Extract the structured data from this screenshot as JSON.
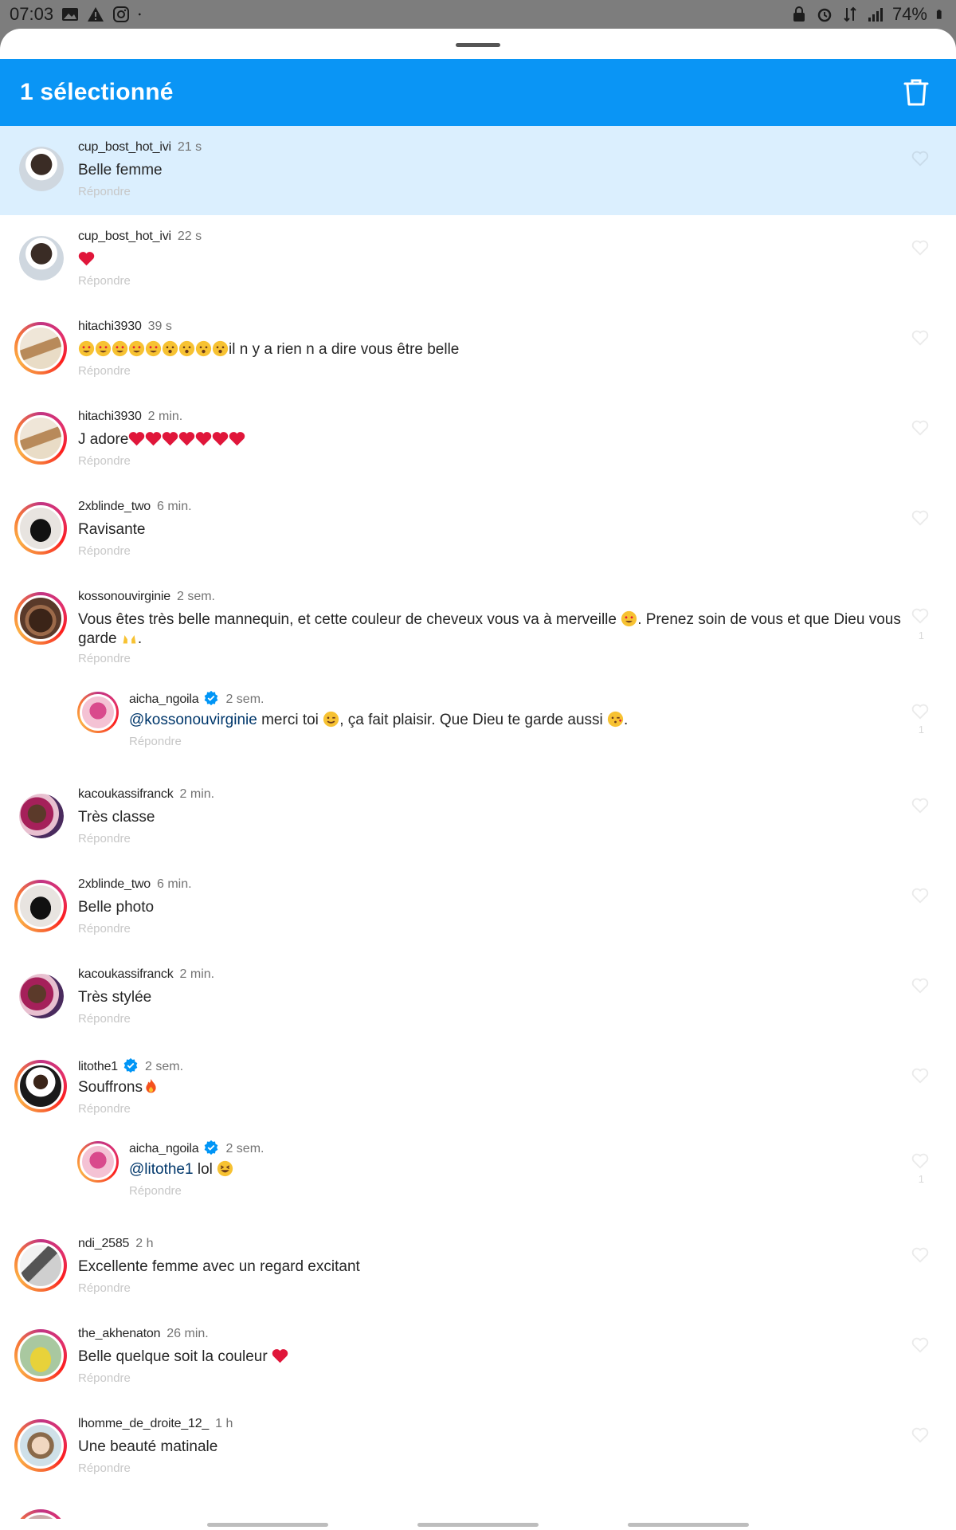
{
  "status_bar": {
    "time": "07:03",
    "battery": "74%",
    "left_icons": [
      "image-icon",
      "warning-icon",
      "instagram-icon",
      "dot-icon"
    ],
    "right_icons": [
      "lock-icon",
      "alarm-icon",
      "signal-transfer-icon",
      "signal-icon",
      "battery-icon"
    ]
  },
  "action_bar": {
    "title": "1 sélectionné",
    "trash_icon": "trash-icon",
    "color": "#0a95f5"
  },
  "reply_label": "Répondre",
  "comments": [
    {
      "username": "cup_bost_hot_ivi",
      "time": "21 s",
      "text": "Belle femme",
      "selected": true
    },
    {
      "username": "cup_bost_hot_ivi",
      "time": "22 s",
      "text": ""
    },
    {
      "username": "hitachi3930",
      "time": "39 s",
      "text": "il n y a rien n a dire vous être belle"
    },
    {
      "username": "hitachi3930",
      "time": "2 min.",
      "text": "J adore"
    },
    {
      "username": "2xblinde_two",
      "time": "6 min.",
      "text": "Ravisante"
    },
    {
      "username": "kossonouvirginie",
      "time": "2 sem.",
      "text_parts": [
        "Vous êtes très belle mannequin, et cette couleur de cheveux vous va à merveille ",
        ". Prenez soin de vous et que Dieu vous",
        "garde ",
        "."
      ],
      "likes": "1"
    },
    {
      "username": "aicha_ngoila",
      "time": "2 sem.",
      "verified": true,
      "mention": "@kossonouvirginie",
      "text_parts": [
        " merci toi ",
        ", ça fait plaisir. Que Dieu te garde aussi ",
        "."
      ],
      "likes": "1"
    },
    {
      "username": "kacoukassifranck",
      "time": "2 min.",
      "text": "Très classe"
    },
    {
      "username": "2xblinde_two",
      "time": "6 min.",
      "text": "Belle photo"
    },
    {
      "username": "kacoukassifranck",
      "time": "2 min.",
      "text": "Très stylée"
    },
    {
      "username": "litothe1",
      "time": "2 sem.",
      "verified": true,
      "text": "Souffrons"
    },
    {
      "username": "aicha_ngoila",
      "time": "2 sem.",
      "verified": true,
      "mention": "@litothe1",
      "text": " lol ",
      "likes": "1"
    },
    {
      "username": "ndi_2585",
      "time": "2 h",
      "text": "Excellente femme avec un regard excitant"
    },
    {
      "username": "the_akhenaton",
      "time": "26 min.",
      "text": "Belle quelque soit la couleur "
    },
    {
      "username": "lhomme_de_droite_12_",
      "time": "1 h",
      "text": "Une beauté matinale"
    }
  ],
  "colors": {
    "selected_bg": "#dbeffe",
    "mention": "#00376b",
    "heart": "#e0163a"
  }
}
